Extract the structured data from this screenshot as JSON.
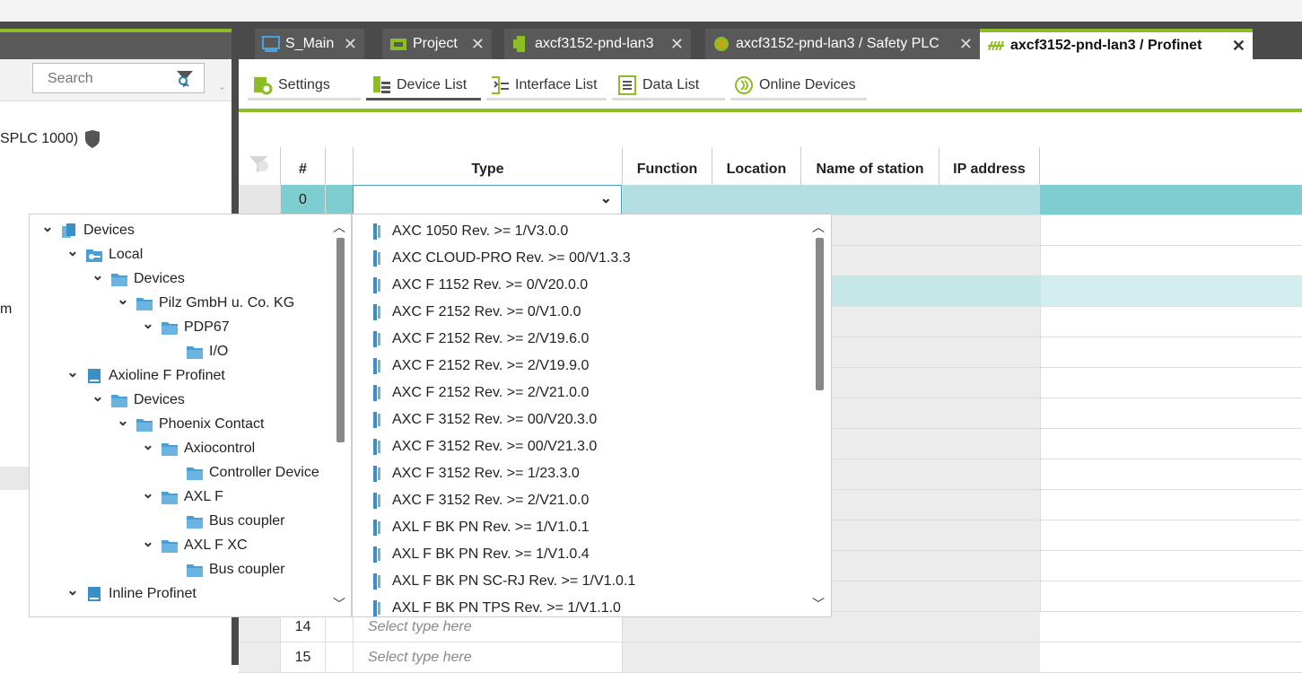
{
  "tabs": [
    {
      "label": "S_Main",
      "icon": "plc-screen-icon"
    },
    {
      "label": "Project",
      "icon": "project-folder-icon"
    },
    {
      "label": "axcf3152-pnd-lan3",
      "icon": "controller-icon"
    },
    {
      "label": "axcf3152-pnd-lan3 / Safety PLC",
      "icon": "safety-plc-icon"
    },
    {
      "label": "axcf3152-pnd-lan3 / Profinet",
      "icon": "profinet-icon"
    }
  ],
  "left_panel": {
    "search_placeholder": "Search",
    "item_partial_1": "SPLC 1000)",
    "item_partial_2": "m"
  },
  "toolbar": [
    {
      "label": "Settings",
      "icon": "settings-icon"
    },
    {
      "label": "Device List",
      "icon": "device-list-icon"
    },
    {
      "label": "Interface List",
      "icon": "interface-list-icon"
    },
    {
      "label": "Data List",
      "icon": "data-list-icon"
    },
    {
      "label": "Online Devices",
      "icon": "online-devices-icon"
    }
  ],
  "grid": {
    "columns": [
      "#",
      "",
      "Type",
      "Function",
      "Location",
      "Name of station",
      "IP address"
    ],
    "first_row_number": "0",
    "visible_rows": [
      {
        "number": "14",
        "type_placeholder": "Select type here"
      },
      {
        "number": "15",
        "type_placeholder": "Select type here"
      }
    ]
  },
  "tree": [
    {
      "label": "Devices",
      "level": 0,
      "expanded": true,
      "icon": "devices-icon"
    },
    {
      "label": "Local",
      "level": 1,
      "expanded": true,
      "icon": "local-icon"
    },
    {
      "label": "Devices",
      "level": 2,
      "expanded": true,
      "icon": "folder-icon"
    },
    {
      "label": "Pilz GmbH u. Co. KG",
      "level": 3,
      "expanded": true,
      "icon": "folder-icon"
    },
    {
      "label": "PDP67",
      "level": 4,
      "expanded": true,
      "icon": "folder-icon"
    },
    {
      "label": "I/O",
      "level": 5,
      "expanded": false,
      "icon": "folder-icon"
    },
    {
      "label": "Axioline F Profinet",
      "level": 1,
      "expanded": true,
      "icon": "bus-icon"
    },
    {
      "label": "Devices",
      "level": 2,
      "expanded": true,
      "icon": "folder-icon"
    },
    {
      "label": "Phoenix Contact",
      "level": 3,
      "expanded": true,
      "icon": "folder-icon"
    },
    {
      "label": "Axiocontrol",
      "level": 4,
      "expanded": true,
      "icon": "folder-icon"
    },
    {
      "label": "Controller Device",
      "level": 5,
      "expanded": false,
      "icon": "folder-icon"
    },
    {
      "label": "AXL F",
      "level": 4,
      "expanded": true,
      "icon": "folder-icon"
    },
    {
      "label": "Bus coupler",
      "level": 5,
      "expanded": false,
      "icon": "folder-icon"
    },
    {
      "label": "AXL F XC",
      "level": 4,
      "expanded": true,
      "icon": "folder-icon"
    },
    {
      "label": "Bus coupler",
      "level": 5,
      "expanded": false,
      "icon": "folder-icon"
    },
    {
      "label": "Inline Profinet",
      "level": 1,
      "expanded": true,
      "icon": "bus-icon"
    }
  ],
  "device_types": [
    "AXC 1050 Rev. >= 1/V3.0.0",
    "AXC CLOUD-PRO Rev. >= 00/V1.3.3",
    "AXC F 1152 Rev. >= 0/V20.0.0",
    "AXC F 2152 Rev. >= 0/V1.0.0",
    "AXC F 2152 Rev. >= 2/V19.6.0",
    "AXC F 2152 Rev. >= 2/V19.9.0",
    "AXC F 2152 Rev. >= 2/V21.0.0",
    "AXC F 3152 Rev. >= 00/V20.3.0",
    "AXC F 3152 Rev. >= 00/V21.3.0",
    "AXC F 3152 Rev. >= 1/23.3.0",
    "AXC F 3152 Rev. >= 2/V21.0.0",
    "AXL F BK PN Rev. >= 1/V1.0.1",
    "AXL F BK PN Rev. >= 1/V1.0.4",
    "AXL F BK PN SC-RJ Rev. >= 1/V1.0.1",
    "AXL F BK PN TPS Rev. >= 1/V1.1.0"
  ],
  "colors": {
    "accent_green": "#8cbd26",
    "selected_row": "#7ecdd1",
    "device_blue": "#3a8fc4",
    "folder_blue": "#4a9fd4"
  }
}
